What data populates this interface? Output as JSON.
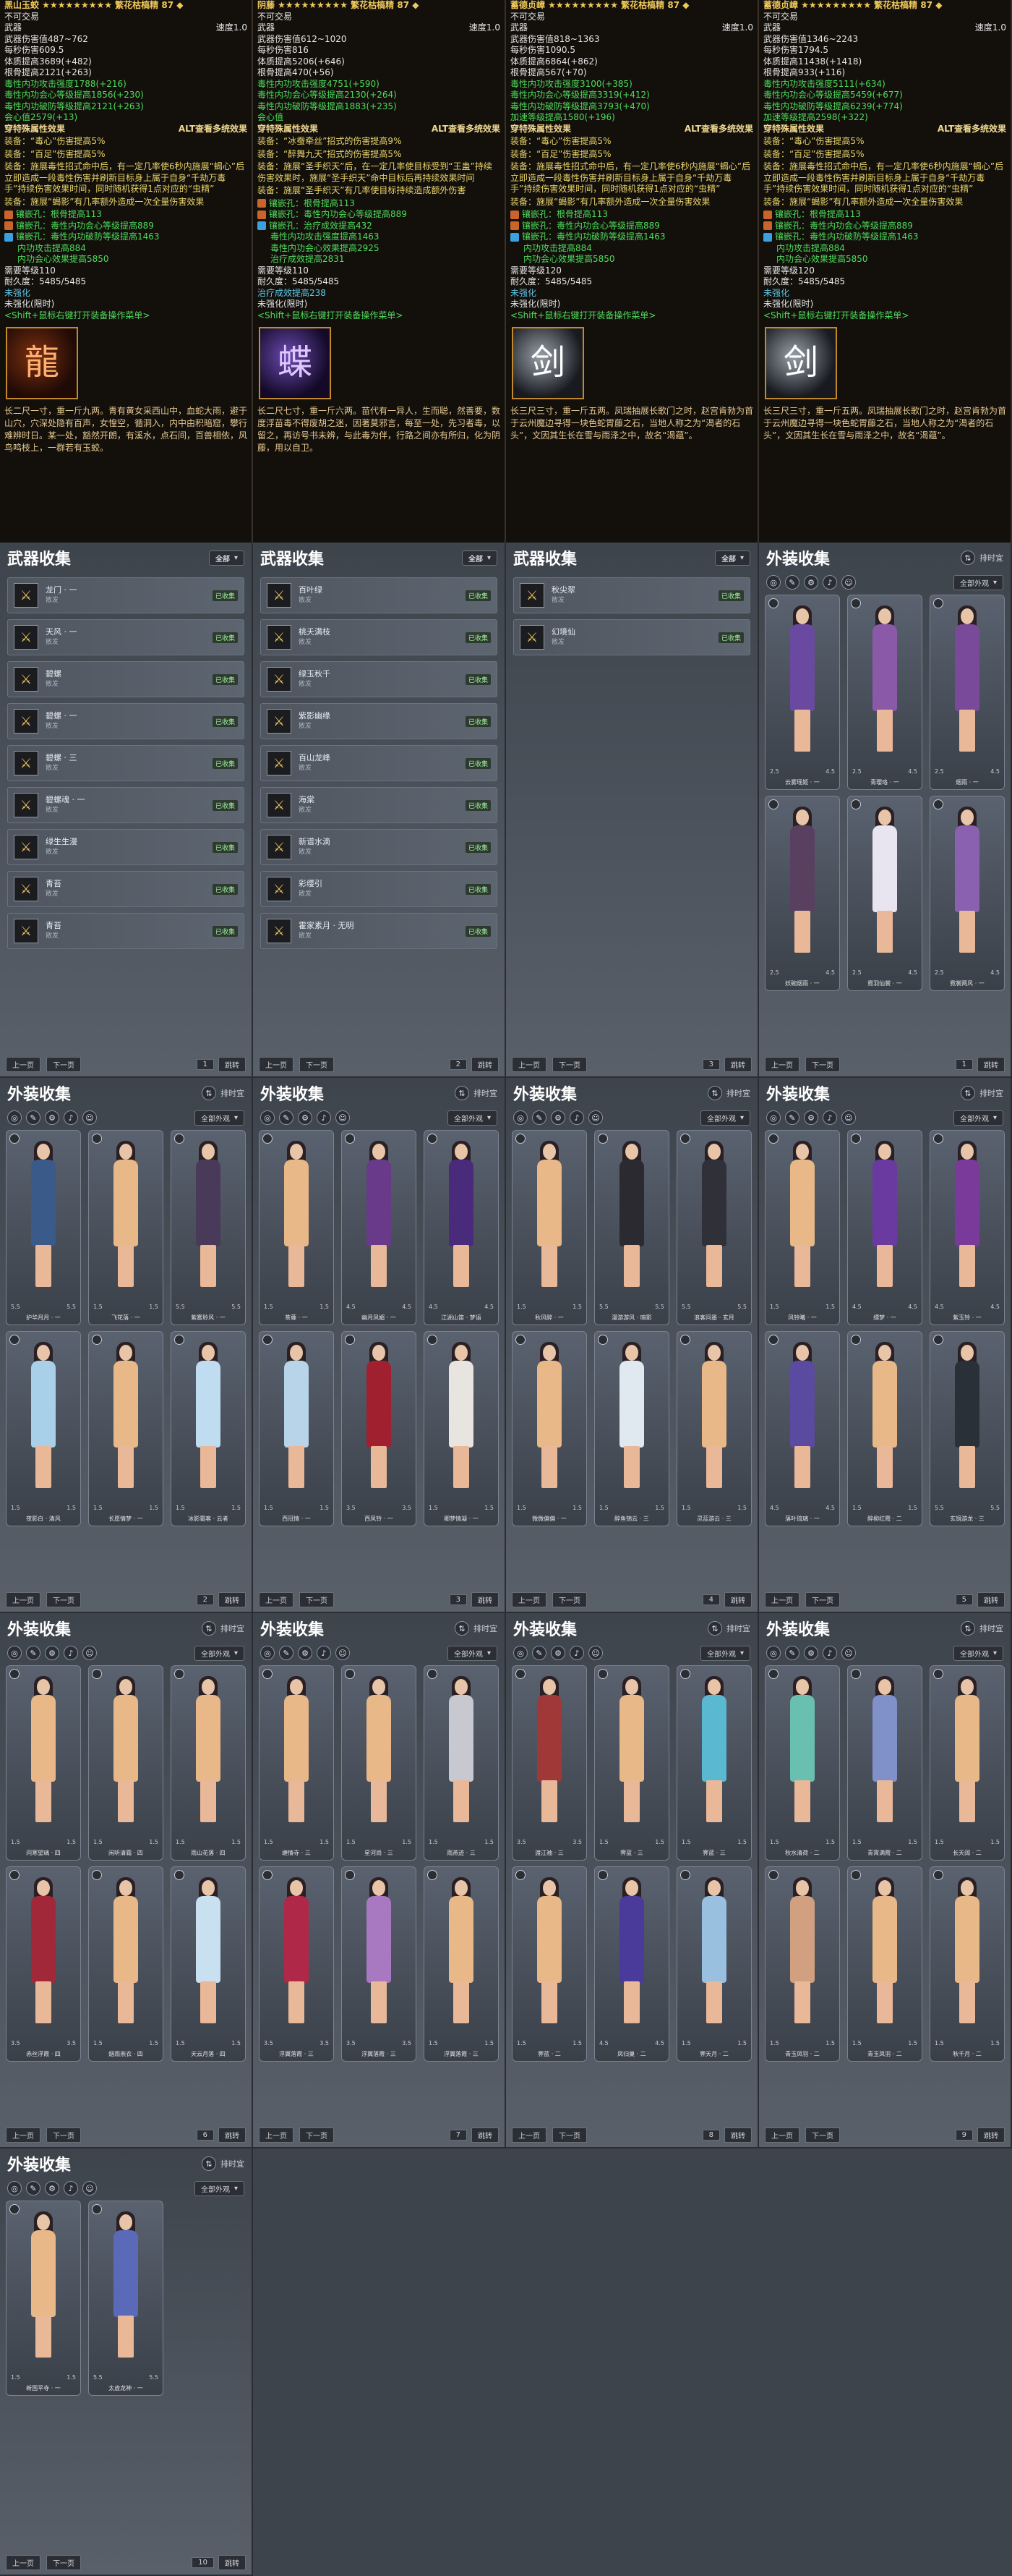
{
  "colors": {
    "panel": "#4b5159",
    "tooltip": "#13100c",
    "gold": "#f0c85a",
    "green": "#4ddc5a"
  },
  "tooltips": [
    {
      "title": "黑山玉蛟 ★★★★★★★★★ 繁花枯槁精 87 ◆",
      "bind": "不可交易",
      "type": "武器",
      "dur": "速度1.0",
      "atk": "武器伤害值487~762",
      "dps": "每秒伤害609.5",
      "crit": "体质提高3689(+482)",
      "hp": "根骨提高2121(+263)",
      "lines": [
        "毒性内功攻击强度1788(+216)",
        "毒性内功会心等级提高1856(+230)",
        "毒性内功破防等级提高2121(+263)",
        "会心值2579(+13)"
      ],
      "hdr": "穿特殊属性效果",
      "alt": "ALT查看多统效果",
      "effects": [
        "装备：“毒心”伤害提高5%",
        "装备：“百足”伤害提高5%",
        "装备：施展毒性招式命中后，有一定几率使6秒内施展“蝎心”后立即造成一段毒性伤害并刷新目标身上属于自身“千劫万毒手”持续伤害效果时间，同时随机获得1点对应的“虫精”",
        "装备：施展“蝎影”有几率额外造成一次全量伤害效果"
      ],
      "gems": [
        "镶嵌孔：根骨提高113",
        "镶嵌孔：毒性内功会心等级提高889",
        "镶嵌孔：毒性内功破防等级提高1463"
      ],
      "sub": [
        "内功攻击提高884",
        "内功会心效果提高5850"
      ],
      "level": "需要等级110",
      "dura": "耐久度：5485/5485",
      "forge": "未强化",
      "bindlimit": "未强化(限时)",
      "hint": "<Shift+鼠标右键打开装备操作菜单>",
      "iconGlyph": "龍",
      "desc": "长二尺一寸，重一斤九两。青有黄女采西山中，血蛇大雨，避于山穴，穴深处隐有百声，女惶空，循洞入，内中由积暗窟，攀行难辨时日。某一处，豁然开朗，有溪水，点石间，百兽相依，风鸟鸣枝上，一群若有玉蛟。",
      "iconCls": ""
    },
    {
      "title": "阴藤 ★★★★★★★★★ 繁花枯槁精 87 ◆",
      "bind": "不可交易",
      "type": "武器",
      "dur": "速度1.0",
      "atk": "武器伤害值612~1020",
      "dps": "每秒伤害816",
      "crit": "体质提高5206(+646)",
      "hp": "根骨提高470(+56)",
      "lines": [
        "毒性内功攻击强度4751(+590)",
        "毒性内功会心等级提高2130(+264)",
        "毒性内功破防等级提高1883(+235)",
        "会心值"
      ],
      "hdr": "穿特殊属性效果",
      "alt": "ALT查看多统效果",
      "effects": [
        "装备：“冰蚕牵丝”招式的伤害提高9%",
        "装备：“醉舞九天”招式的伤害提高5%",
        "装备：施展“圣手织天”后，在一定几率使目标受到“王蛊”持续伤害效果时，施展“圣手织天”命中目标后再持续效果时间",
        "装备：施展“圣手织天”有几率使目标持续造成额外伤害"
      ],
      "gems": [
        "镶嵌孔：根骨提高113",
        "镶嵌孔：毒性内功会心等级提高889",
        "镶嵌孔：治疗成效提高432"
      ],
      "sub": [
        "毒性内功攻击强度提高1463",
        "毒性内功会心效果提高2925",
        "治疗成效提高2831"
      ],
      "level": "需要等级110",
      "dura": "耐久度：5485/5485",
      "forge": "治疗成效提高238",
      "bindlimit": "未强化(限时)",
      "hint": "<Shift+鼠标右键打开装备操作菜单>",
      "iconGlyph": "蝶",
      "desc": "长二尺七寸，重一斤六两。苗代有一异人，生而聪，然善要，数度浮苗毒不得废胡之迷，因著莫邪言，每至一处，先习者毒，以留之，再访号书未辨，与此毒为伴，行路之间亦有所归，化为阴藤，用以自卫。",
      "iconCls": "p"
    },
    {
      "title": "蓄德贞嶂 ★★★★★★★★★ 繁花枯槁精 87 ◆",
      "bind": "不可交易",
      "type": "武器",
      "dur": "速度1.0",
      "atk": "武器伤害值818~1363",
      "dps": "每秒伤害1090.5",
      "crit": "体质提高6864(+862)",
      "hp": "根骨提高567(+70)",
      "lines": [
        "毒性内功攻击强度3100(+385)",
        "毒性内功会心等级提高3319(+412)",
        "毒性内功破防等级提高3793(+470)",
        "加速等级提高1580(+196)"
      ],
      "hdr": "穿特殊属性效果",
      "alt": "ALT查看多统效果",
      "effects": [
        "装备：“毒心”伤害提高5%",
        "装备：“百足”伤害提高5%",
        "装备：施展毒性招式命中后，有一定几率使6秒内施展“蝎心”后立即造成一段毒性伤害并刷新目标身上属于自身“千劫万毒手”持续伤害效果时间，同时随机获得1点对应的“虫精”",
        "装备：施展“蝎影”有几率额外造成一次全量伤害效果"
      ],
      "gems": [
        "镶嵌孔：根骨提高113",
        "镶嵌孔：毒性内功会心等级提高889",
        "镶嵌孔：毒性内功破防等级提高1463"
      ],
      "sub": [
        "内功攻击提高884",
        "内功会心效果提高5850"
      ],
      "level": "需要等级120",
      "dura": "耐久度：5485/5485",
      "forge": "未强化",
      "bindlimit": "未强化(限时)",
      "hint": "<Shift+鼠标右键打开装备操作菜单>",
      "iconGlyph": "剑",
      "desc": "长三尺三寸，重一斤五两。凤瑞抽展长歌门之时，赵宫肯勃为首于云州魔边寻得一块色蛇胃藤之石，当地人称之为“渴者的石头”，文因其生长在雪与雨泽之中，故名“渴蕴”。",
      "iconCls": "s"
    },
    {
      "title": "蓄德贞嶂 ★★★★★★★★★ 繁花枯槁精 87 ◆",
      "bind": "不可交易",
      "type": "武器",
      "dur": "速度1.0",
      "atk": "武器伤害值1346~2243",
      "dps": "每秒伤害1794.5",
      "crit": "体质提高11438(+1418)",
      "hp": "根骨提高933(+116)",
      "lines": [
        "毒性内功攻击强度5111(+634)",
        "毒性内功会心等级提高5459(+677)",
        "毒性内功破防等级提高6239(+774)",
        "加速等级提高2598(+322)"
      ],
      "hdr": "穿特殊属性效果",
      "alt": "ALT查看多统效果",
      "effects": [
        "装备：“毒心”伤害提高5%",
        "装备：“百足”伤害提高5%",
        "装备：施展毒性招式命中后，有一定几率使6秒内施展“蝎心”后立即造成一段毒性伤害并刷新目标身上属于自身“千劫万毒手”持续伤害效果时间，同时随机获得1点对应的“虫精”",
        "装备：施展“蝎影”有几率额外造成一次全量伤害效果"
      ],
      "gems": [
        "镶嵌孔：根骨提高113",
        "镶嵌孔：毒性内功会心等级提高889",
        "镶嵌孔：毒性内功破防等级提高1463"
      ],
      "sub": [
        "内功攻击提高884",
        "内功会心效果提高5850"
      ],
      "level": "需要等级120",
      "dura": "耐久度：5485/5485",
      "forge": "未强化",
      "bindlimit": "未强化(限时)",
      "hint": "<Shift+鼠标右键打开装备操作菜单>",
      "iconGlyph": "剑",
      "desc": "长三尺三寸，重一斤五两。凤瑞抽展长歌门之时，赵宫肯勃为首于云州魔边寻得一块色蛇胃藤之石，当地人称之为“渴者的石头”，文因其生长在雪与雨泽之中，故名“渴蕴”。",
      "iconCls": "s"
    }
  ],
  "weapon_title": "武器收集",
  "outfit_title": "外装收集",
  "filter_all": "全部",
  "filter_outfit": "全部外观",
  "sort_label": "排时宜",
  "prev": "上一页",
  "next": "下一页",
  "jump": "跳转",
  "tools": [
    "◎",
    "✎",
    "⚙",
    "♪",
    "☺"
  ],
  "weapon_panels": [
    {
      "items": [
        {
          "n": "龙门 · 一",
          "s": "散发",
          "t": "已收集"
        },
        {
          "n": "天风 · 一",
          "s": "散发",
          "t": "已收集"
        },
        {
          "n": "碧螺",
          "s": "散发",
          "t": "已收集"
        },
        {
          "n": "碧螺 · 一",
          "s": "散发",
          "t": "已收集"
        },
        {
          "n": "碧螺 · 三",
          "s": "散发",
          "t": "已收集"
        },
        {
          "n": "碧螺魂 · 一",
          "s": "散发",
          "t": "已收集"
        },
        {
          "n": "绿生生漫",
          "s": "散发",
          "t": "已收集"
        },
        {
          "n": "青苔",
          "s": "散发",
          "t": "已收集"
        },
        {
          "n": "青苔",
          "s": "散发",
          "t": "已收集"
        }
      ],
      "page": "1",
      "total": "1"
    },
    {
      "items": [
        {
          "n": "百叶绿",
          "s": "散发",
          "t": "已收集"
        },
        {
          "n": "桃夭满枝",
          "s": "散发",
          "t": "已收集"
        },
        {
          "n": "绿玉秋千",
          "s": "散发",
          "t": "已收集"
        },
        {
          "n": "紫影幽缘",
          "s": "散发",
          "t": "已收集"
        },
        {
          "n": "百山龙峰",
          "s": "散发",
          "t": "已收集"
        },
        {
          "n": "海棠",
          "s": "散发",
          "t": "已收集"
        },
        {
          "n": "新谱水滴",
          "s": "散发",
          "t": "已收集"
        },
        {
          "n": "彩缨引",
          "s": "散发",
          "t": "已收集"
        },
        {
          "n": "霍家素月 · 无明",
          "s": "散发",
          "t": "已收集"
        }
      ],
      "page": "2",
      "total": "1"
    },
    {
      "items": [
        {
          "n": "秋尖翠",
          "s": "散发",
          "t": "已收集"
        },
        {
          "n": "幻境仙",
          "s": "散发",
          "t": "已收集"
        }
      ],
      "page": "3",
      "total": "1"
    }
  ],
  "outfit_panels": [
    {
      "row": 0,
      "col": 3,
      "page": "1",
      "cards": [
        {
          "l": "云雾瑶姬 · 一",
          "c": "#6a4aa0",
          "s1": "2.5",
          "s2": "4.5"
        },
        {
          "l": "青璎珞 · 一",
          "c": "#8a5aa8",
          "s1": "2.5",
          "s2": "4.5"
        },
        {
          "l": "烟雨 · 一",
          "c": "#7a4a9a",
          "s1": "2.5",
          "s2": "4.5"
        },
        {
          "l": "妖碗烟雨 · 一",
          "c": "#5a4060",
          "s1": "2.5",
          "s2": "4.5"
        },
        {
          "l": "霓羽仙裳 · 一",
          "c": "#e8e4f0",
          "s1": "2.5",
          "s2": "4.5"
        },
        {
          "l": "霓裳两风 · 一",
          "c": "#8a60b0",
          "s1": "2.5",
          "s2": "4.5"
        }
      ]
    },
    {
      "row": 1,
      "col": 0,
      "page": "2",
      "cards": [
        {
          "l": "护华月月 · 一",
          "c": "#3a5a8a",
          "s1": "5.5",
          "s2": "5.5"
        },
        {
          "l": "飞花落 · 一",
          "c": "#e8b888",
          "s1": "1.5",
          "s2": "1.5"
        },
        {
          "l": "紫雾聆风 · 一",
          "c": "#4a3a5a",
          "s1": "5.5",
          "s2": "5.5"
        },
        {
          "l": "夜影白 · 清风",
          "c": "#a8d0e8",
          "s1": "1.5",
          "s2": "1.5"
        },
        {
          "l": "长愿情梦 · 一",
          "c": "#e8b888",
          "s1": "1.5",
          "s2": "1.5"
        },
        {
          "l": "冰影霜客 · 云者",
          "c": "#c0dcf0",
          "s1": "1.5",
          "s2": "1.5"
        }
      ]
    },
    {
      "row": 1,
      "col": 1,
      "page": "3",
      "cards": [
        {
          "l": "茶蘼 · 一",
          "c": "#e8b888",
          "s1": "1.5",
          "s2": "1.5"
        },
        {
          "l": "幽月凤媚 · 一",
          "c": "#6a3a8a",
          "s1": "4.5",
          "s2": "4.5"
        },
        {
          "l": "江湖山笛 · 梦语",
          "c": "#4a2a7a",
          "s1": "4.5",
          "s2": "4.5"
        },
        {
          "l": "西冠情 · 一",
          "c": "#b8d4e8",
          "s1": "1.5",
          "s2": "1.5"
        },
        {
          "l": "西凤铃 · 一",
          "c": "#a02030",
          "s1": "3.5",
          "s2": "3.5"
        },
        {
          "l": "卿梦情凝 · 一",
          "c": "#e8e4e0",
          "s1": "1.5",
          "s2": "1.5"
        }
      ]
    },
    {
      "row": 1,
      "col": 2,
      "page": "4",
      "cards": [
        {
          "l": "秋风醉 · 一",
          "c": "#e8b888",
          "s1": "1.5",
          "s2": "1.5"
        },
        {
          "l": "漫游游风 · 暗影",
          "c": "#2a2a30",
          "s1": "5.5",
          "s2": "5.5"
        },
        {
          "l": "浪客问墨 · 玄月",
          "c": "#303038",
          "s1": "5.5",
          "s2": "5.5"
        },
        {
          "l": "微微偏偏 · 一",
          "c": "#e8b888",
          "s1": "1.5",
          "s2": "1.5"
        },
        {
          "l": "醉鱼锦云 · 三",
          "c": "#e0e8f0",
          "s1": "1.5",
          "s2": "1.5"
        },
        {
          "l": "灵蕊游云 · 三",
          "c": "#e8b888",
          "s1": "1.5",
          "s2": "1.5"
        }
      ]
    },
    {
      "row": 1,
      "col": 3,
      "page": "5",
      "cards": [
        {
          "l": "风铃曦 · 一",
          "c": "#e8b888",
          "s1": "1.5",
          "s2": "1.5"
        },
        {
          "l": "缥梦 · 一",
          "c": "#6a3aa0",
          "s1": "4.5",
          "s2": "4.5"
        },
        {
          "l": "紫玉铃 · 一",
          "c": "#7a3a9a",
          "s1": "4.5",
          "s2": "4.5"
        },
        {
          "l": "落叶琉璃 · 一",
          "c": "#5a4aa0",
          "s1": "4.5",
          "s2": "4.5"
        },
        {
          "l": "醉柳红霞 · 二",
          "c": "#e8b888",
          "s1": "1.5",
          "s2": "1.5"
        },
        {
          "l": "玄镜游龙 · 三",
          "c": "#2a3038",
          "s1": "5.5",
          "s2": "5.5"
        }
      ]
    },
    {
      "row": 2,
      "col": 0,
      "page": "6",
      "cards": [
        {
          "l": "问寒望璃 · 四",
          "c": "#e8b888",
          "s1": "1.5",
          "s2": "1.5"
        },
        {
          "l": "闲听清霜 · 四",
          "c": "#e8b888",
          "s1": "1.5",
          "s2": "1.5"
        },
        {
          "l": "雨山花落 · 四",
          "c": "#e8b888",
          "s1": "1.5",
          "s2": "1.5"
        },
        {
          "l": "赤丝浮霞 · 四",
          "c": "#a02838",
          "s1": "3.5",
          "s2": "3.5"
        },
        {
          "l": "烟雨燕衣 · 四",
          "c": "#e8b888",
          "s1": "1.5",
          "s2": "1.5"
        },
        {
          "l": "天云月落 · 四",
          "c": "#c8e0f0",
          "s1": "1.5",
          "s2": "1.5"
        }
      ]
    },
    {
      "row": 2,
      "col": 1,
      "page": "7",
      "cards": [
        {
          "l": "缠情寺 · 三",
          "c": "#e8b888",
          "s1": "1.5",
          "s2": "1.5"
        },
        {
          "l": "星河尚 · 三",
          "c": "#e8b888",
          "s1": "1.5",
          "s2": "1.5"
        },
        {
          "l": "雨燕迹 · 三",
          "c": "#c8c8d0",
          "s1": "1.5",
          "s2": "1.5"
        },
        {
          "l": "浮翼落霞 · 三",
          "c": "#b02848",
          "s1": "3.5",
          "s2": "3.5"
        },
        {
          "l": "浮翼落霞 · 三",
          "c": "#a878c0",
          "s1": "3.5",
          "s2": "3.5"
        },
        {
          "l": "浮翼落霞 · 三",
          "c": "#e8b888",
          "s1": "1.5",
          "s2": "1.5"
        }
      ]
    },
    {
      "row": 2,
      "col": 2,
      "page": "8",
      "cards": [
        {
          "l": "渡江袖 · 三",
          "c": "#a03838",
          "s1": "3.5",
          "s2": "3.5"
        },
        {
          "l": "霁蓝 · 三",
          "c": "#e8b888",
          "s1": "1.5",
          "s2": "1.5"
        },
        {
          "l": "霁蓝 · 三",
          "c": "#5ab8d0",
          "s1": "1.5",
          "s2": "1.5"
        },
        {
          "l": "霁蓝 · 二",
          "c": "#e8b888",
          "s1": "1.5",
          "s2": "1.5"
        },
        {
          "l": "凤归巢 · 二",
          "c": "#4a3a9a",
          "s1": "4.5",
          "s2": "4.5"
        },
        {
          "l": "霁天月 · 二",
          "c": "#9ac0e0",
          "s1": "1.5",
          "s2": "1.5"
        }
      ]
    },
    {
      "row": 2,
      "col": 3,
      "page": "9",
      "cards": [
        {
          "l": "秋水清荷 · 二",
          "c": "#6ac0b0",
          "s1": "1.5",
          "s2": "1.5"
        },
        {
          "l": "青霄满霞 · 二",
          "c": "#8090c8",
          "s1": "1.5",
          "s2": "1.5"
        },
        {
          "l": "长天阔 · 二",
          "c": "#e8b888",
          "s1": "1.5",
          "s2": "1.5"
        },
        {
          "l": "青玉凤羽 · 二",
          "c": "#d0a080",
          "s1": "1.5",
          "s2": "1.5"
        },
        {
          "l": "青玉凤羽 · 二",
          "c": "#e8b888",
          "s1": "1.5",
          "s2": "1.5"
        },
        {
          "l": "秋千月 · 二",
          "c": "#e8b888",
          "s1": "1.5",
          "s2": "1.5"
        }
      ]
    },
    {
      "row": 3,
      "col": 0,
      "page": "10",
      "cards": [
        {
          "l": "新国平寺 · 一",
          "c": "#e8b888",
          "s1": "1.5",
          "s2": "1.5"
        },
        {
          "l": "太虚龙神 · 一",
          "c": "#5a6ab8",
          "s1": "5.5",
          "s2": "5.5"
        }
      ]
    }
  ]
}
